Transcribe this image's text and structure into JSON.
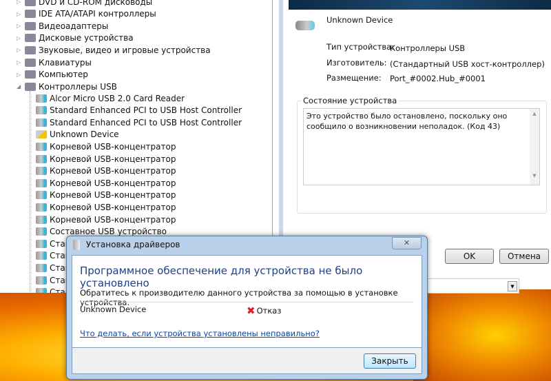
{
  "tree": {
    "categories": [
      {
        "label": "DVD и CD-ROM дисководы",
        "icon": "dvd-drive-icon"
      },
      {
        "label": "IDE ATA/ATAPI контроллеры",
        "icon": "ide-controller-icon"
      },
      {
        "label": "Видеоадаптеры",
        "icon": "display-adapter-icon"
      },
      {
        "label": "Дисковые устройства",
        "icon": "disk-drive-icon"
      },
      {
        "label": "Звуковые, видео и игровые устройства",
        "icon": "speaker-icon"
      },
      {
        "label": "Клавиатуры",
        "icon": "keyboard-icon"
      },
      {
        "label": "Компьютер",
        "icon": "computer-icon"
      },
      {
        "label": "Контроллеры USB",
        "icon": "usb-icon",
        "expanded": true
      }
    ],
    "usb_children": [
      "Alcor Micro USB 2.0 Card Reader",
      "Standard Enhanced PCI to USB Host Controller",
      "Standard Enhanced PCI to USB Host Controller",
      "Unknown Device",
      "Корневой USB-концентратор",
      "Корневой USB-концентратор",
      "Корневой USB-концентратор",
      "Корневой USB-концентратор",
      "Корневой USB-концентратор",
      "Корневой USB-концентратор",
      "Корневой USB-концентратор",
      "Составное USB устройство",
      "Стан",
      "Стан",
      "Стан",
      "Стан",
      "Стан"
    ]
  },
  "properties": {
    "device_name": "Unknown Device",
    "type_label": "Тип устройства:",
    "type_value": "Контроллеры USB",
    "manufacturer_label": "Изготовитель:",
    "manufacturer_value": "(Стандартный USB хост-контроллер)",
    "location_label": "Размещение:",
    "location_value": "Port_#0002.Hub_#0001",
    "status_group": "Состояние устройства",
    "status_text": "Это устройство было остановлено, поскольку оно сообщило о возникновении неполадок. (Код 43)",
    "ok": "OK",
    "cancel": "Отмена"
  },
  "driver_dialog": {
    "title": "Установка драйверов",
    "close_glyph": "✕",
    "heading": "Программное обеспечение для устройства не было установлено",
    "text": "Обратитесь к производителю данного устройства за помощью в установке устройства.",
    "device": "Unknown Device",
    "status": "Отказ",
    "help_link": "Что делать, если устройства установлены неправильно?",
    "close_button": "Закрыть"
  },
  "colors": {
    "heading": "#1e3d8a",
    "link": "#0645ad",
    "error": "#dd2222"
  }
}
